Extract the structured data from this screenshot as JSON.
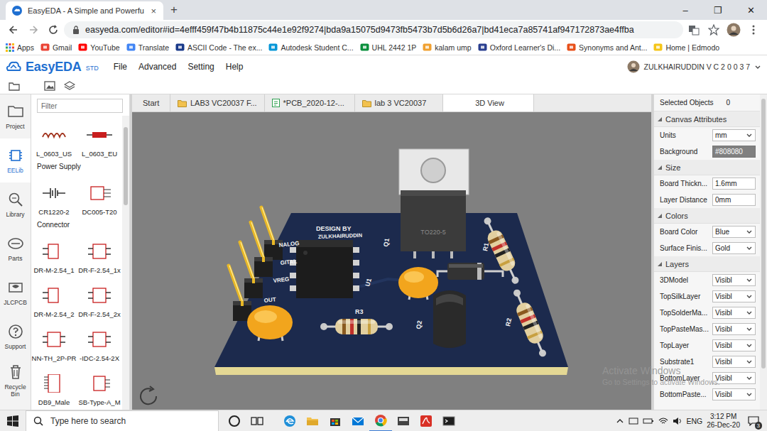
{
  "browser": {
    "tab": {
      "title": "EasyEDA - A Simple and Powerfu",
      "close": "×",
      "selected": true
    },
    "new_tab": "+",
    "window_controls": [
      "–",
      "❐",
      "✕"
    ],
    "address": "easyeda.com/editor#id=4efff459f47b4b11875c44e1e92f9274|bda9a15075d9473fb5473b7d5b6d26a7|bd41eca7a85741af947172873ae4ffba",
    "bookmarks": [
      "Apps",
      "Gmail",
      "YouTube",
      "Translate",
      "ASCII Code - The ex...",
      "Autodesk Student C...",
      "UHL 2442 1P",
      "kalam ump",
      "Oxford Learner's Di...",
      "Synonyms and Ant...",
      "Home | Edmodo"
    ]
  },
  "app": {
    "logo": "EasyEDA",
    "edition": "STD",
    "menu": [
      "File",
      "Advanced",
      "Setting",
      "Help"
    ],
    "user": "ZULKHAIRUDDIN V C 2 0 0 3 7",
    "nav": [
      {
        "label": "Project",
        "selected": false
      },
      {
        "label": "EELib",
        "selected": true
      },
      {
        "label": "Library",
        "selected": false
      },
      {
        "label": "Parts",
        "selected": false
      },
      {
        "label": "JLCPCB",
        "selected": false
      },
      {
        "label": "Support",
        "selected": false
      },
      {
        "label": "Recycle Bin",
        "selected": false
      }
    ],
    "library": {
      "filter_placeholder": "Filter",
      "entries": [
        {
          "kind": "parts",
          "items": [
            "L_0603_US",
            "L_0603_EU"
          ]
        },
        {
          "kind": "header",
          "label": "Power Supply"
        },
        {
          "kind": "parts",
          "items": [
            "CR1220-2",
            "DC005-T20"
          ]
        },
        {
          "kind": "header",
          "label": "Connector"
        },
        {
          "kind": "parts",
          "items": [
            "DR-M-2.54_1",
            "DR-F-2.54_1x"
          ]
        },
        {
          "kind": "parts",
          "items": [
            "DR-M-2.54_2",
            "DR-F-2.54_2x"
          ]
        },
        {
          "kind": "parts",
          "items": [
            "NN-TH_2P-PR",
            "-IDC-2.54-2X"
          ]
        },
        {
          "kind": "parts",
          "items": [
            "DB9_Male",
            "SB-Type-A_M"
          ]
        }
      ]
    },
    "tabs": [
      {
        "label": "Start",
        "kind": "plain",
        "selected": false
      },
      {
        "label": "LAB3 VC20037 F...",
        "kind": "folder",
        "selected": false
      },
      {
        "label": "*PCB_2020-12-...",
        "kind": "pcb",
        "selected": false
      },
      {
        "label": "lab 3 VC20037",
        "kind": "folder",
        "selected": false
      },
      {
        "label": "3D View",
        "kind": "plain",
        "selected": true
      }
    ],
    "board": {
      "silkscreen": [
        "DESIGN BY",
        "ZULKHAIRUDDIN",
        "NALOG",
        "GITAL",
        "VREG",
        "OUT",
        "Q1",
        "U1",
        "R1",
        "R2",
        "R3",
        "Q2"
      ],
      "package_label": "TO220-5"
    },
    "properties": {
      "selected_label": "Selected Objects",
      "selected_count": "0",
      "sections": [
        {
          "title": "Canvas Attributes",
          "rows": [
            {
              "label": "Units",
              "value": "mm",
              "kind": "select"
            },
            {
              "label": "Background",
              "value": "#808080",
              "kind": "color"
            }
          ]
        },
        {
          "title": "Size",
          "rows": [
            {
              "label": "Board Thickn...",
              "value": "1.6mm",
              "kind": "input"
            },
            {
              "label": "Layer Distance",
              "value": "0mm",
              "kind": "input"
            }
          ]
        },
        {
          "title": "Colors",
          "rows": [
            {
              "label": "Board Color",
              "value": "Blue",
              "kind": "select"
            },
            {
              "label": "Surface Finis...",
              "value": "Gold",
              "kind": "select"
            }
          ]
        },
        {
          "title": "Layers",
          "rows": [
            {
              "label": "3DModel",
              "value": "Visibl",
              "kind": "select"
            },
            {
              "label": "TopSilkLayer",
              "value": "Visibl",
              "kind": "select"
            },
            {
              "label": "TopSolderMa...",
              "value": "Visibl",
              "kind": "select"
            },
            {
              "label": "TopPasteMas...",
              "value": "Visibl",
              "kind": "select"
            },
            {
              "label": "TopLayer",
              "value": "Visibl",
              "kind": "select"
            },
            {
              "label": "Substrate1",
              "value": "Visibl",
              "kind": "select"
            },
            {
              "label": "BottomLayer",
              "value": "Visibl",
              "kind": "select"
            },
            {
              "label": "BottomPaste...",
              "value": "Visibl",
              "kind": "select"
            }
          ]
        }
      ]
    }
  },
  "watermark": {
    "title": "Activate Windows",
    "subtitle": "Go to Settings to activate Windows."
  },
  "taskbar": {
    "search_placeholder": "Type here to search",
    "language": "ENG",
    "time": "3:12 PM",
    "date": "26-Dec-20",
    "notifications": "3"
  }
}
